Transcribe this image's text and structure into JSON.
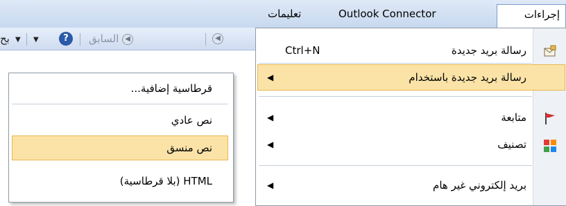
{
  "menubar": {
    "items": [
      {
        "label": "تعليمات"
      },
      {
        "label": "Outlook Connector"
      },
      {
        "label": "إجراءات"
      }
    ]
  },
  "toolbar": {
    "back_label": "السابق",
    "partial_text": "بح"
  },
  "main_menu": {
    "items": [
      {
        "label": "رسالة بريد جديدة",
        "shortcut": "Ctrl+N"
      },
      {
        "label": "رسالة بريد جديدة باستخدام",
        "arrow": "◀"
      },
      {
        "label": "متابعة",
        "arrow": "◀"
      },
      {
        "label": "تصنيف",
        "arrow": "◀"
      },
      {
        "label": "بريد إلكتروني غير هام",
        "arrow": "◀"
      }
    ]
  },
  "submenu": {
    "items": [
      {
        "label": "قرطاسية إضافية..."
      },
      {
        "label": "نص عادي"
      },
      {
        "label": "نص منسق"
      },
      {
        "label": "HTML  (بلا قرطاسية)"
      }
    ]
  },
  "colors": {
    "highlight_fill": "#fbe3a8",
    "highlight_border": "#e8b84c",
    "menubar": "#d3e1f4"
  }
}
